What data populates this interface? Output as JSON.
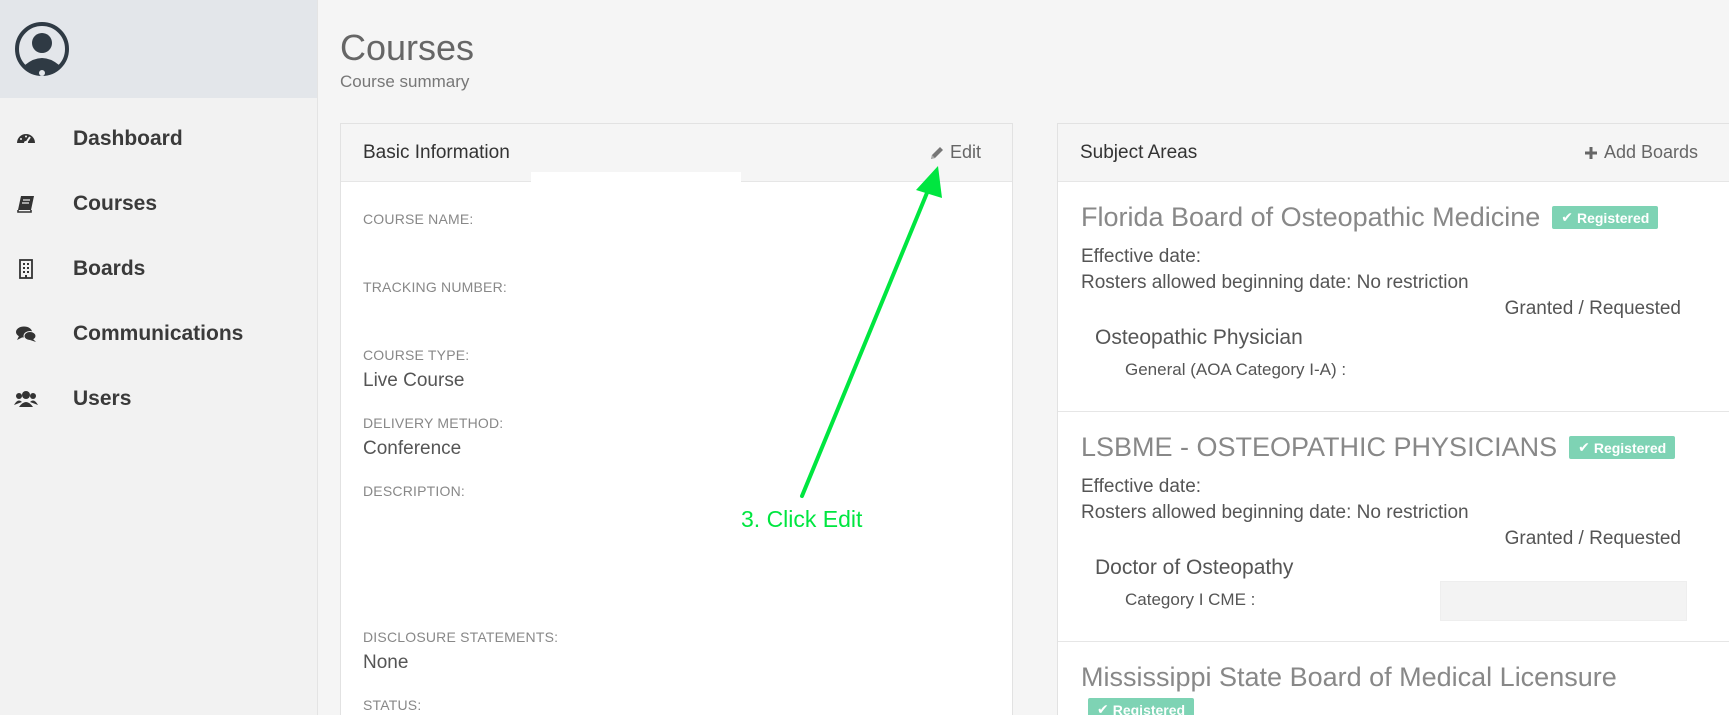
{
  "sidebar": {
    "items": [
      {
        "label": "Dashboard",
        "icon": "dashboard-icon"
      },
      {
        "label": "Courses",
        "icon": "book-icon"
      },
      {
        "label": "Boards",
        "icon": "building-icon"
      },
      {
        "label": "Communications",
        "icon": "comments-icon"
      },
      {
        "label": "Users",
        "icon": "users-icon"
      }
    ]
  },
  "header": {
    "title": "Courses",
    "subtitle": "Course summary"
  },
  "basic_info": {
    "title": "Basic Information",
    "edit_label": "Edit",
    "fields": {
      "course_name_label": "COURSE NAME:",
      "course_name_value": "",
      "tracking_number_label": "TRACKING NUMBER:",
      "tracking_number_value": "",
      "course_type_label": "COURSE TYPE:",
      "course_type_value": "Live Course",
      "delivery_method_label": "DELIVERY METHOD:",
      "delivery_method_value": "Conference",
      "description_label": "DESCRIPTION:",
      "description_value": "",
      "disclosure_label": "DISCLOSURE STATEMENTS:",
      "disclosure_value": "None",
      "status_label": "STATUS:"
    }
  },
  "subject_areas": {
    "title": "Subject Areas",
    "add_label": "Add Boards",
    "boards": [
      {
        "name": "Florida Board of Osteopathic Medicine",
        "badge": "Registered",
        "effective_date": "Effective date:",
        "rosters": "Rosters allowed beginning date: No restriction",
        "granted": "Granted / Requested",
        "profession": "Osteopathic Physician",
        "category": "General (AOA Category I-A) :"
      },
      {
        "name": "LSBME - OSTEOPATHIC PHYSICIANS",
        "badge": "Registered",
        "effective_date": "Effective date:",
        "rosters": "Rosters allowed beginning date: No restriction",
        "granted": "Granted / Requested",
        "profession": "Doctor of Osteopathy",
        "category": "Category I CME :"
      },
      {
        "name": "Mississippi State Board of Medical Licensure",
        "badge": "Registered"
      }
    ]
  },
  "annotation": {
    "text": "3. Click Edit",
    "color": "#00e640"
  },
  "colors": {
    "badge": "#7ed3b4",
    "sidebar_header": "#e3e6ea"
  }
}
